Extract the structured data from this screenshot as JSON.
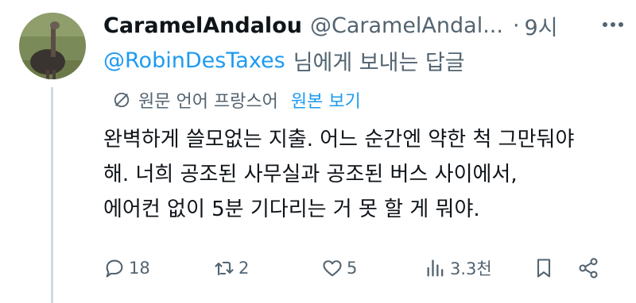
{
  "tweet": {
    "author": {
      "display_name": "CaramelAndalou",
      "handle": "@CaramelAndal...",
      "avatar_icon": "ostrich-avatar"
    },
    "separator": "·",
    "time": "9시",
    "reply_to": {
      "mention": "@RobinDesTaxes",
      "suffix": "님에게 보내는 답글"
    },
    "translate": {
      "icon": "globe-slash-icon",
      "label": "원문 언어 프랑스어",
      "link": "원본 보기"
    },
    "body_lines": [
      "완벽하게 쓸모없는 지출. 어느 순간엔 약한 척 그만둬야",
      "해. 너희 공조된 사무실과 공조된 버스 사이에서,",
      "에어컨 없이 5분 기다리는 거 못 할 게 뭐야."
    ],
    "actions": {
      "replies": "18",
      "retweets": "2",
      "likes": "5",
      "views": "3.3천"
    },
    "colors": {
      "accent": "#1d9bf0",
      "secondary_text": "#536471",
      "primary_text": "#0f1419",
      "thread_line": "#cfd9de"
    }
  }
}
